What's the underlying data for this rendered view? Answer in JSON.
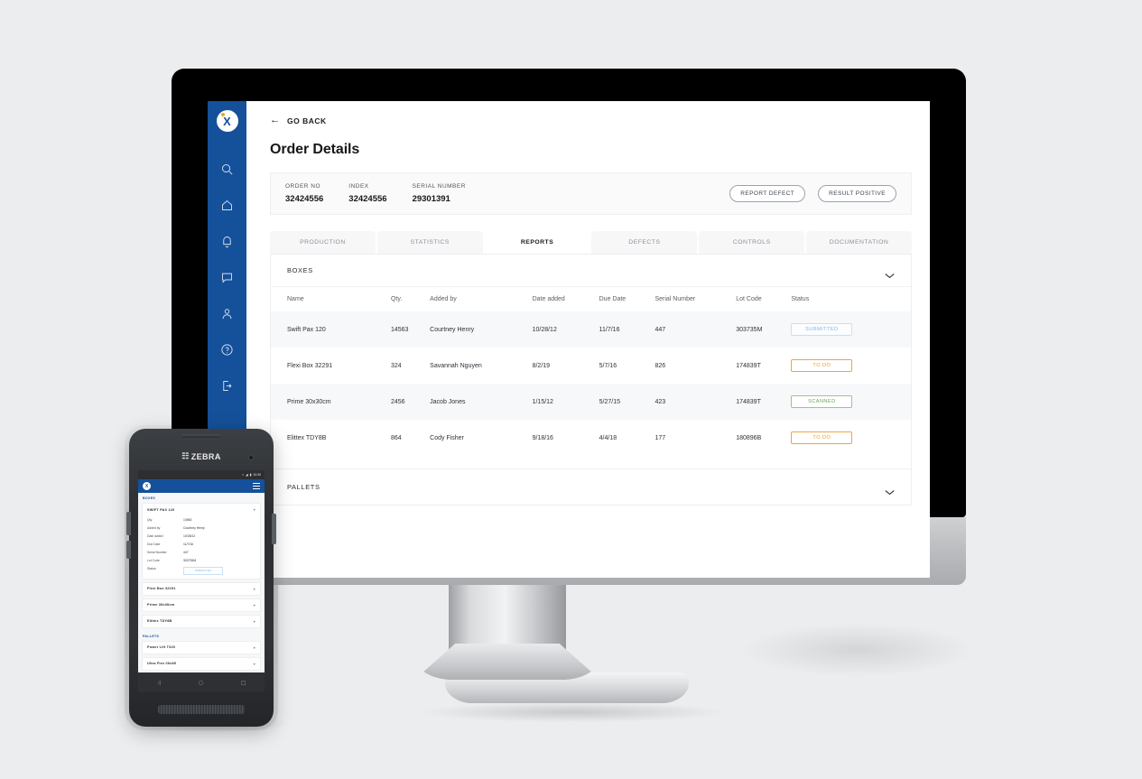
{
  "sidebar": {
    "logo": {
      "letter": "X",
      "name": "app-logo"
    },
    "items": [
      {
        "icon": "search-icon",
        "label": "Search"
      },
      {
        "icon": "home-icon",
        "label": "Home"
      },
      {
        "icon": "bell-icon",
        "label": "Notifications"
      },
      {
        "icon": "chat-icon",
        "label": "Messages"
      },
      {
        "icon": "user-icon",
        "label": "Profile"
      },
      {
        "icon": "help-icon",
        "label": "Help"
      },
      {
        "icon": "logout-icon",
        "label": "Log out"
      }
    ]
  },
  "header": {
    "back_label": "GO BACK",
    "back_arrow": "←",
    "title": "Order Details"
  },
  "info_bar": {
    "fields": [
      {
        "key": "ORDER NO",
        "value": "32424556"
      },
      {
        "key": "INDEX",
        "value": "32424556"
      },
      {
        "key": "SERIAL NUMBER",
        "value": "29301391"
      }
    ],
    "actions": [
      {
        "label": "REPORT DEFECT"
      },
      {
        "label": "RESULT POSITIVE"
      }
    ]
  },
  "tabs": [
    {
      "label": "PRODUCTION",
      "active": false
    },
    {
      "label": "STATISTICS",
      "active": false
    },
    {
      "label": "REPORTS",
      "active": true
    },
    {
      "label": "DEFECTS",
      "active": false
    },
    {
      "label": "CONTROLS",
      "active": false
    },
    {
      "label": "DOCUMENTATION",
      "active": false
    }
  ],
  "boxes_panel": {
    "title": "BOXES",
    "columns": [
      "Name",
      "Qty.",
      "Added by",
      "Date added",
      "Due Date",
      "Serial Number",
      "Lot Code",
      "Status"
    ],
    "rows": [
      {
        "name": "Swift Pax 120",
        "qty": "14563",
        "added_by": "Courtney Henry",
        "date_added": "10/28/12",
        "due_date": "11/7/16",
        "serial_number": "447",
        "lot_code": "303735M",
        "status": "SUBMITTED",
        "status_kind": "submitted"
      },
      {
        "name": "Flexi Box 32291",
        "qty": "324",
        "added_by": "Savannah Nguyen",
        "date_added": "8/2/19",
        "due_date": "5/7/16",
        "serial_number": "826",
        "lot_code": "174839T",
        "status": "TO DO",
        "status_kind": "todo"
      },
      {
        "name": "Prime  30x30cm",
        "qty": "2456",
        "added_by": "Jacob Jones",
        "date_added": "1/15/12",
        "due_date": "5/27/15",
        "serial_number": "423",
        "lot_code": "174839T",
        "status": "SCANNED",
        "status_kind": "scanned"
      },
      {
        "name": "Elittex TDY8B",
        "qty": "864",
        "added_by": "Cody Fisher",
        "date_added": "9/18/16",
        "due_date": "4/4/18",
        "serial_number": "177",
        "lot_code": "180896B",
        "status": "TO DO",
        "status_kind": "todo"
      }
    ]
  },
  "pallets_panel": {
    "title": "PALLETS"
  },
  "colors": {
    "sidebar_blue": "#15509a",
    "accent_orange": "#f5a623",
    "status_submitted": "#7fb6e8",
    "status_todo": "#f3a33c",
    "status_scanned": "#6da45c",
    "page_background": "#ecedef"
  },
  "phone": {
    "brand": "ZEBRA",
    "status_bar": {
      "time": "10:30"
    },
    "appbar": {
      "logo_letter": "X"
    },
    "sections": [
      {
        "title": "BOXES",
        "cards": [
          {
            "title": "SWIFT PAX 120",
            "expanded": true,
            "rows": [
              {
                "key": "Qty.",
                "value": "14563"
              },
              {
                "key": "Added by",
                "value": "Courtney Henry"
              },
              {
                "key": "Date added",
                "value": "10/28/12"
              },
              {
                "key": "Due Date",
                "value": "11/7/16"
              },
              {
                "key": "Serial Number",
                "value": "447"
              },
              {
                "key": "Lot Code",
                "value": "303735M"
              }
            ],
            "status_key": "Status",
            "status": "SUBMITTED"
          },
          {
            "title": "Flexi Box 32291",
            "expanded": false
          },
          {
            "title": "Prime 30x30cm",
            "expanded": false
          },
          {
            "title": "Elittex TDY8B",
            "expanded": false
          }
        ]
      },
      {
        "title": "PALLETS",
        "cards": [
          {
            "title": "Power Lift T320",
            "expanded": false
          },
          {
            "title": "Ultra Flex 06x85",
            "expanded": false
          }
        ]
      }
    ]
  }
}
